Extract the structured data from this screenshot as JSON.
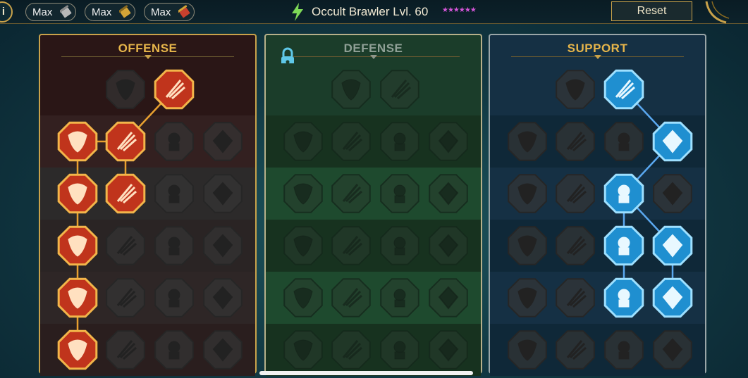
{
  "topbar": {
    "info_label": "i",
    "max_buttons": [
      {
        "label": "Max",
        "icon": "silver-scroll-icon",
        "accent": "#b8b8b8"
      },
      {
        "label": "Max",
        "icon": "gold-scroll-icon",
        "accent": "#d4a437"
      },
      {
        "label": "Max",
        "icon": "red-scroll-icon",
        "accent": "#c8402e"
      }
    ],
    "champion_title": "Occult Brawler Lvl. 60",
    "stars": "★★★★★★",
    "reset_label": "Reset"
  },
  "panels": {
    "offense": {
      "title": "OFFENSE",
      "accent": "#e6b54a"
    },
    "defense": {
      "title": "DEFENSE",
      "accent": "#8fa096",
      "locked": true
    },
    "support": {
      "title": "SUPPORT",
      "accent": "#e6b54a"
    }
  },
  "colors": {
    "offense_active": "#c0341c",
    "support_active": "#1f8fd0",
    "inactive": "#3a3a3a"
  },
  "mastery_rows": {
    "offense": [
      [
        {
          "icon": "crossed-swords-icon",
          "state": "inactive"
        },
        {
          "icon": "dagger-slash-icon",
          "state": "active"
        }
      ],
      [
        {
          "icon": "demon-figure-icon",
          "state": "active"
        },
        {
          "icon": "claw-strike-icon",
          "state": "active"
        },
        {
          "icon": "shield-slash-icon",
          "state": "inactive"
        },
        {
          "icon": "heart-claw-icon",
          "state": "inactive"
        }
      ],
      [
        {
          "icon": "knight-arrows-icon",
          "state": "active"
        },
        {
          "icon": "fanged-maw-icon",
          "state": "active"
        },
        {
          "icon": "skull-icon",
          "state": "inactive"
        },
        {
          "icon": "sickle-icon",
          "state": "inactive"
        }
      ],
      [
        {
          "icon": "bleeding-heart-icon",
          "state": "active"
        },
        {
          "icon": "gauntlet-icon",
          "state": "inactive"
        },
        {
          "icon": "axe-icon",
          "state": "inactive"
        },
        {
          "icon": "chain-lightning-icon",
          "state": "inactive"
        }
      ],
      [
        {
          "icon": "blades-burst-icon",
          "state": "active"
        },
        {
          "icon": "skull-bones-icon",
          "state": "inactive"
        },
        {
          "icon": "sword-ring-icon",
          "state": "inactive"
        },
        {
          "icon": "warrior-pose-icon",
          "state": "inactive"
        }
      ],
      [
        {
          "icon": "warrior-sword-icon",
          "state": "active"
        },
        {
          "icon": "visored-helm-icon",
          "state": "inactive"
        },
        {
          "icon": "spider-icon",
          "state": "inactive"
        },
        {
          "icon": "spartan-helm-icon",
          "state": "inactive"
        }
      ]
    ],
    "defense": [
      [
        {
          "icon": "cracked-wall-icon",
          "state": "inactive"
        },
        {
          "icon": "raised-fist-icon",
          "state": "inactive"
        }
      ],
      [
        {
          "icon": "helm-icon",
          "state": "inactive"
        },
        {
          "icon": "arm-guard-icon",
          "state": "inactive"
        },
        {
          "icon": "heavy-armor-icon",
          "state": "inactive"
        },
        {
          "icon": "blade-block-icon",
          "state": "inactive"
        }
      ],
      [
        {
          "icon": "cloak-icon",
          "state": "inactive"
        },
        {
          "icon": "plated-shield-icon",
          "state": "inactive"
        },
        {
          "icon": "skull-icon",
          "state": "inactive"
        },
        {
          "icon": "hooded-figure-icon",
          "state": "inactive"
        }
      ],
      [
        {
          "icon": "dual-figure-icon",
          "state": "inactive"
        },
        {
          "icon": "hourglass-icon",
          "state": "inactive"
        },
        {
          "icon": "open-hand-icon",
          "state": "inactive"
        },
        {
          "icon": "bull-skull-icon",
          "state": "inactive"
        }
      ],
      [
        {
          "icon": "runner-icon",
          "state": "inactive"
        },
        {
          "icon": "flame-icon",
          "state": "inactive"
        },
        {
          "icon": "skull-ring-icon",
          "state": "inactive"
        },
        {
          "icon": "wing-icon",
          "state": "inactive"
        }
      ],
      [
        {
          "icon": "mask-icon",
          "state": "inactive"
        },
        {
          "icon": "ribbed-shield-icon",
          "state": "inactive"
        },
        {
          "icon": "skull-helm-icon",
          "state": "inactive"
        },
        {
          "icon": "giant-icon",
          "state": "inactive"
        }
      ]
    ],
    "support": [
      [
        {
          "icon": "heart-plus-icon",
          "state": "inactive"
        },
        {
          "icon": "spiral-wind-icon",
          "state": "active"
        }
      ],
      [
        {
          "icon": "praying-hands-icon",
          "state": "inactive"
        },
        {
          "icon": "swirl-shell-icon",
          "state": "inactive"
        },
        {
          "icon": "skull-smoke-icon",
          "state": "inactive"
        },
        {
          "icon": "speed-blade-icon",
          "state": "active"
        }
      ],
      [
        {
          "icon": "sparkle-figure-icon",
          "state": "inactive"
        },
        {
          "icon": "lightning-shield-icon",
          "state": "inactive"
        },
        {
          "icon": "crumbling-icon",
          "state": "active"
        },
        {
          "icon": "silhouette-icon",
          "state": "inactive"
        }
      ],
      [
        {
          "icon": "heart-chain-icon",
          "state": "inactive"
        },
        {
          "icon": "fireball-icon",
          "state": "inactive"
        },
        {
          "icon": "open-book-icon",
          "state": "active"
        },
        {
          "icon": "angry-eyes-icon",
          "state": "active"
        }
      ],
      [
        {
          "icon": "compass-star-icon",
          "state": "inactive"
        },
        {
          "icon": "dashing-foot-icon",
          "state": "inactive"
        },
        {
          "icon": "all-seeing-eye-icon",
          "state": "active"
        },
        {
          "icon": "dancing-figure-icon",
          "state": "active"
        }
      ],
      [
        {
          "icon": "bomb-icon",
          "state": "inactive"
        },
        {
          "icon": "skull-icon",
          "state": "inactive"
        },
        {
          "icon": "helmet-icon",
          "state": "inactive"
        },
        {
          "icon": "eagle-icon",
          "state": "inactive"
        }
      ]
    ]
  }
}
